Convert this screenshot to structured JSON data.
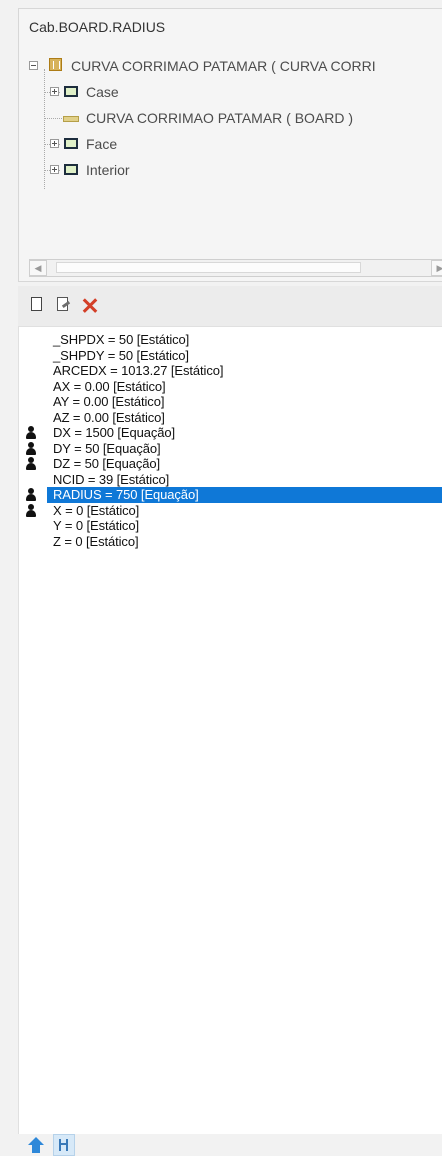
{
  "tree": {
    "title": "Cab.BOARD.RADIUS",
    "root_label": "CURVA CORRIMAO PATAMAR ( CURVA CORRI",
    "items": [
      {
        "label": "Case",
        "icon": "frame-icon",
        "expander": "plus"
      },
      {
        "label": "CURVA CORRIMAO PATAMAR ( BOARD )",
        "icon": "board-icon",
        "expander": "none"
      },
      {
        "label": "Face",
        "icon": "frame-icon",
        "expander": "plus"
      },
      {
        "label": "Interior",
        "icon": "frame-icon",
        "expander": "plus"
      }
    ],
    "scroll_left": "◀",
    "scroll_right": "▶"
  },
  "toolbar": {
    "new_icon": "new-document-icon",
    "edit_icon": "edit-document-icon",
    "delete_icon": "delete-icon",
    "delete_label": "✕"
  },
  "properties": [
    {
      "text": "_SHPDX = 50 [Estático]",
      "user": false,
      "selected": false
    },
    {
      "text": "_SHPDY = 50 [Estático]",
      "user": false,
      "selected": false
    },
    {
      "text": "ARCEDX = 1013.27 [Estático]",
      "user": false,
      "selected": false
    },
    {
      "text": "AX = 0.00 [Estático]",
      "user": false,
      "selected": false
    },
    {
      "text": "AY = 0.00 [Estático]",
      "user": false,
      "selected": false
    },
    {
      "text": "AZ = 0.00 [Estático]",
      "user": false,
      "selected": false
    },
    {
      "text": "DX = 1500 [Equação]",
      "user": true,
      "selected": false
    },
    {
      "text": "DY = 50 [Equação]",
      "user": true,
      "selected": false
    },
    {
      "text": "DZ = 50 [Equação]",
      "user": true,
      "selected": false
    },
    {
      "text": "NCID = 39 [Estático]",
      "user": false,
      "selected": false
    },
    {
      "text": "RADIUS = 750 [Equação]",
      "user": true,
      "selected": true
    },
    {
      "text": "X = 0 [Estático]",
      "user": true,
      "selected": false
    },
    {
      "text": "Y = 0 [Estático]",
      "user": false,
      "selected": false
    },
    {
      "text": "Z = 0 [Estático]",
      "user": false,
      "selected": false
    }
  ],
  "bottom": {
    "home_icon": "home-icon",
    "sort_icon": "sort-icon"
  },
  "colors": {
    "selection": "#0f78d7",
    "delete": "#d33f28",
    "accent": "#2e88d9"
  }
}
